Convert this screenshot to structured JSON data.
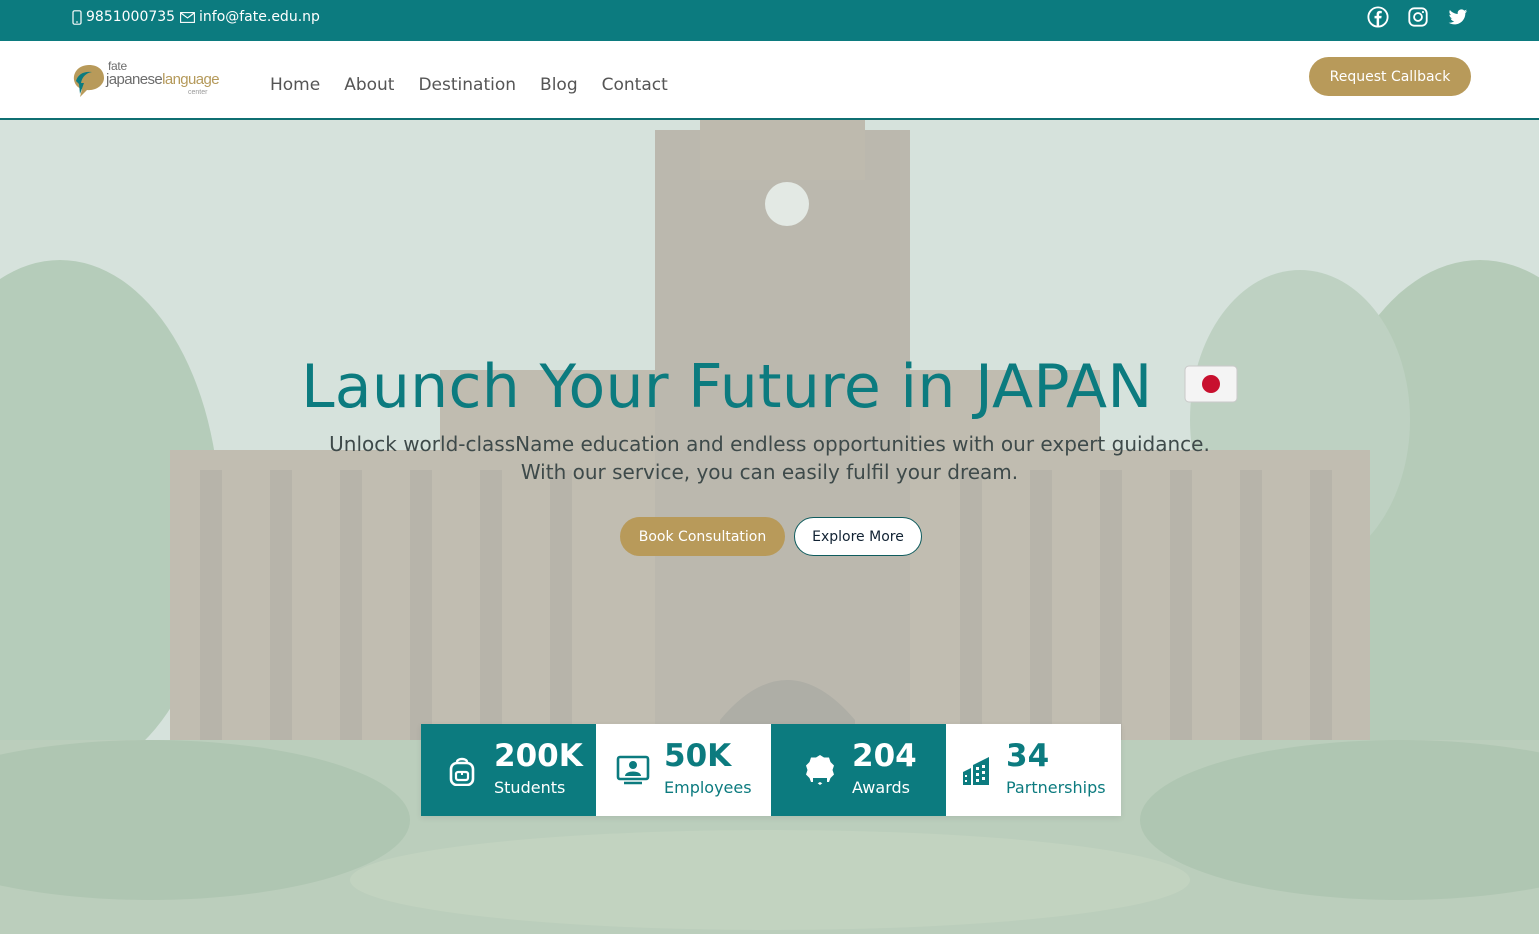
{
  "topbar": {
    "phone": "9851000735",
    "email": "info@fate.edu.np",
    "socials": [
      "facebook-icon",
      "instagram-icon",
      "twitter-icon"
    ]
  },
  "logo": {
    "line1": "fate",
    "line2a": "japanese",
    "line2b": "language",
    "line3": "center"
  },
  "nav": {
    "items": [
      "Home",
      "About",
      "Destination",
      "Blog",
      "Contact"
    ],
    "callback_label": "Request Callback"
  },
  "hero": {
    "title": "Launch Your Future in JAPAN",
    "subtitle_1": "Unlock world-className education and endless opportunities with our expert guidance.",
    "subtitle_2": "With our service, you can easily fulfil your dream.",
    "book_label": "Book Consultation",
    "explore_label": "Explore More"
  },
  "stats": [
    {
      "value": "200K",
      "label": "Students",
      "icon": "backpack-icon"
    },
    {
      "value": "50K",
      "label": "Employees",
      "icon": "employee-icon"
    },
    {
      "value": "204",
      "label": "Awards",
      "icon": "award-icon"
    },
    {
      "value": "34",
      "label": "Partnerships",
      "icon": "buildings-icon"
    }
  ],
  "colors": {
    "primary": "#0c7b7f",
    "accent": "#b89a5a"
  }
}
